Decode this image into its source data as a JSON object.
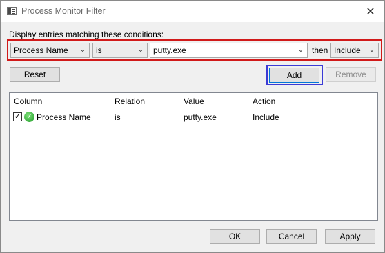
{
  "window": {
    "title": "Process Monitor Filter",
    "close_glyph": "✕",
    "app_icon": "process-monitor-icon"
  },
  "condition": {
    "label": "Display entries matching these conditions:",
    "column_selected": "Process Name",
    "relation_selected": "is",
    "value": "putty.exe",
    "then_label": "then",
    "action_selected": "Include",
    "highlight_color": "#d11a1a"
  },
  "buttons": {
    "reset": "Reset",
    "add": "Add",
    "remove": "Remove",
    "ok": "OK",
    "cancel": "Cancel",
    "apply": "Apply",
    "add_highlight_color": "#3b3bd6"
  },
  "filter_list": {
    "columns": [
      "Column",
      "Relation",
      "Value",
      "Action"
    ],
    "rows": [
      {
        "checked": true,
        "column": "Process Name",
        "relation": "is",
        "value": "putty.exe",
        "action": "Include",
        "icon": "include-check-icon"
      }
    ]
  }
}
